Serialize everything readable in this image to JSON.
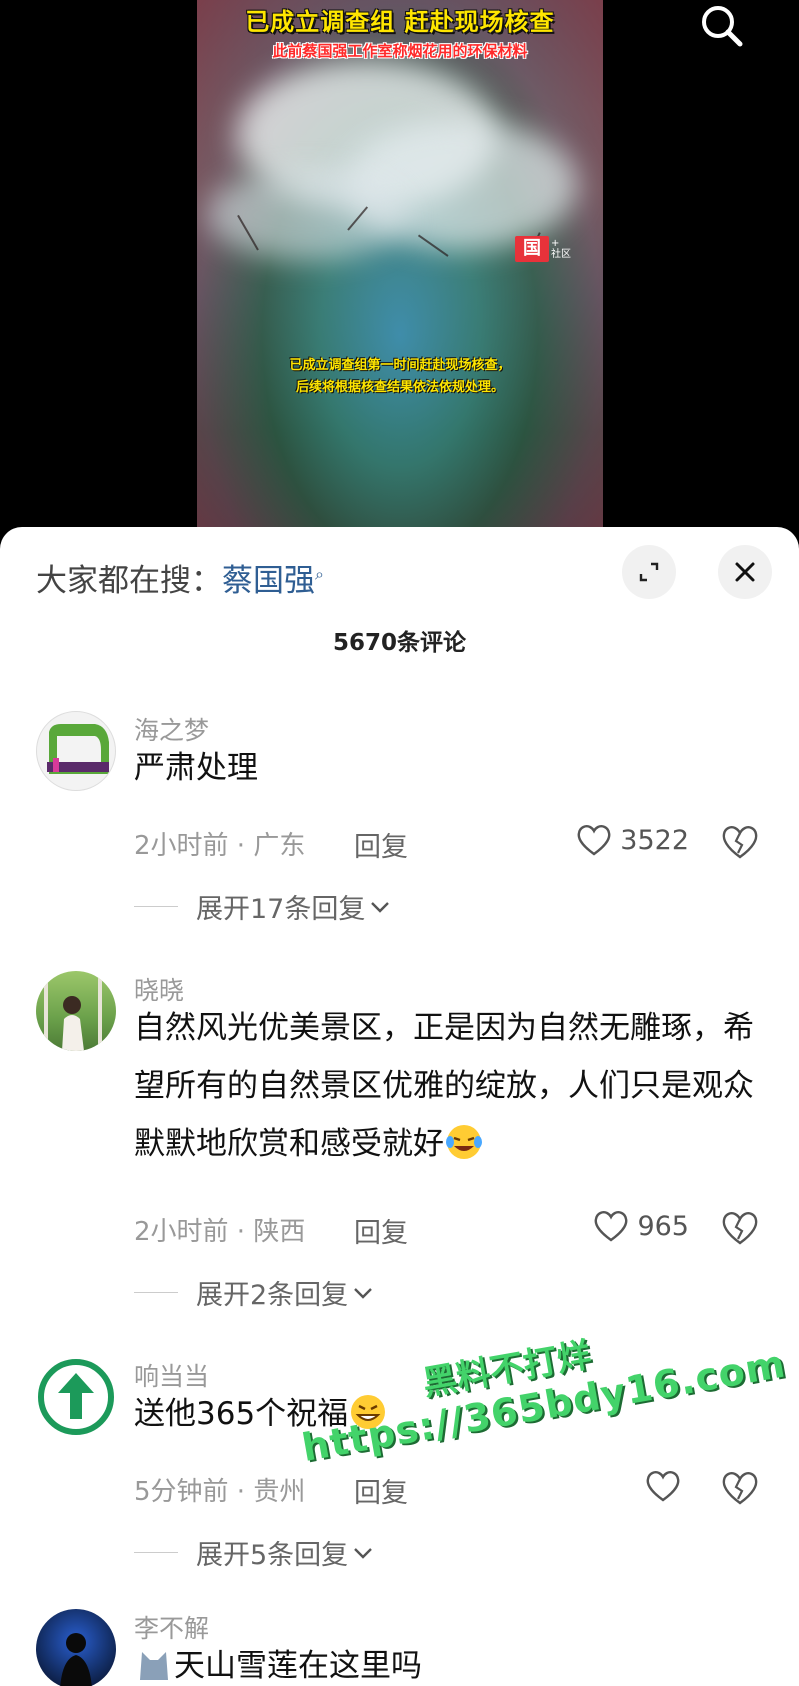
{
  "video": {
    "title": "已成立调查组 赶赴现场核查",
    "subtitle": "此前蔡国强工作室称烟花用的环保材料",
    "caption_line1": "已成立调查组第一时间赶赴现场核查，",
    "caption_line2": "后续将根据核查结果依法依规处理。",
    "logo_char": "国",
    "logo_side": "+\n社区"
  },
  "panel": {
    "hot_search_label": "大家都在搜：",
    "hot_search_keyword": "蔡国强",
    "comment_count": "5670条评论"
  },
  "comments": [
    {
      "user": "海之梦",
      "text": "严肃处理",
      "meta": "2小时前 · 广东",
      "reply": "回复",
      "likes": "3522",
      "expand": "展开17条回复"
    },
    {
      "user": "晓晓",
      "text": "自然风光优美景区，正是因为自然无雕琢，希望所有的自然景区优雅的绽放，人们只是观众默默地欣赏和感受就好",
      "meta": "2小时前 · 陕西",
      "reply": "回复",
      "likes": "965",
      "expand": "展开2条回复"
    },
    {
      "user": "响当当",
      "text": "送他365个祝福",
      "meta": "5分钟前 · 贵州",
      "reply": "回复",
      "likes": "",
      "expand": "展开5条回复"
    },
    {
      "user": "李不解",
      "text": "天山雪莲在这里吗"
    }
  ],
  "watermark": {
    "line1": "黑料不打烊",
    "line2": "https://365bdy16.com"
  },
  "colors": {
    "accent_link": "#2f5e93",
    "muted": "#999999",
    "watermark": "#43d36a"
  }
}
